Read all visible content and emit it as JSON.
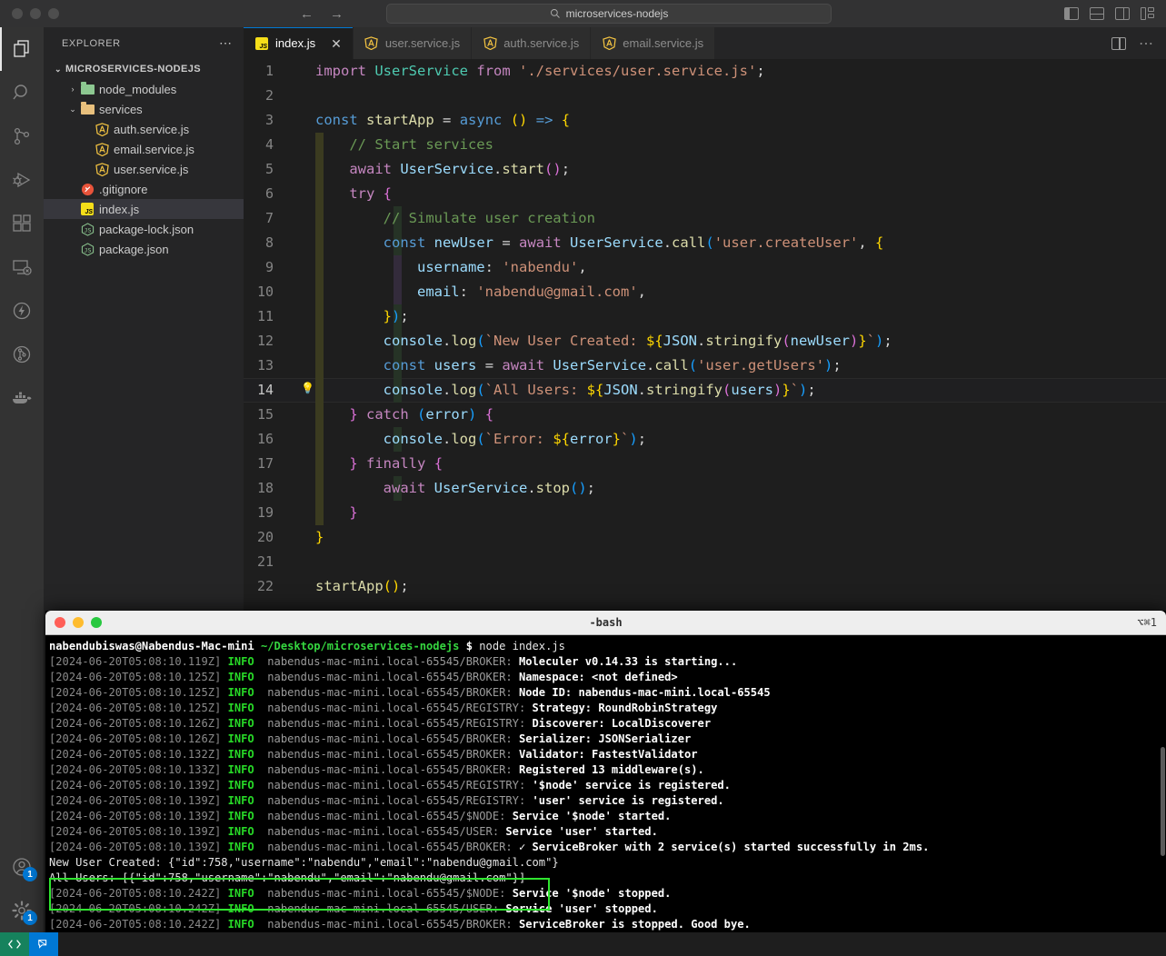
{
  "titlebar": {
    "search_value": "microservices-nodejs",
    "search_icon": "search-icon",
    "back_glyph": "←",
    "forward_glyph": "→"
  },
  "activitybar": {
    "items": [
      {
        "name": "explorer",
        "icon": "files-icon"
      },
      {
        "name": "search",
        "icon": "search-icon"
      },
      {
        "name": "source-control",
        "icon": "source-control-icon"
      },
      {
        "name": "run-and-debug",
        "icon": "run-debug-icon"
      },
      {
        "name": "extensions",
        "icon": "extensions-icon"
      },
      {
        "name": "remote-explorer",
        "icon": "remote-explorer-icon"
      },
      {
        "name": "thunder-client",
        "icon": "thunder-icon"
      },
      {
        "name": "git-graph",
        "icon": "git-graph-icon"
      },
      {
        "name": "docker",
        "icon": "docker-icon"
      }
    ],
    "accounts_badge": "1",
    "settings_badge": "1"
  },
  "sidebar": {
    "title": "EXPLORER",
    "more_actions": "⋯",
    "root": "MICROSERVICES-NODEJS",
    "tree": [
      {
        "label": "node_modules",
        "depth": 1,
        "kind": "folder",
        "color": "#8dc891",
        "expanded": false,
        "chevron": "›"
      },
      {
        "label": "services",
        "depth": 1,
        "kind": "folder",
        "color": "#e8c07d",
        "expanded": true,
        "chevron": "⌄"
      },
      {
        "label": "auth.service.js",
        "depth": 2,
        "kind": "angular",
        "color": "#f5c542"
      },
      {
        "label": "email.service.js",
        "depth": 2,
        "kind": "angular",
        "color": "#f5c542"
      },
      {
        "label": "user.service.js",
        "depth": 2,
        "kind": "angular",
        "color": "#f5c542"
      },
      {
        "label": ".gitignore",
        "depth": 1,
        "kind": "git",
        "color": "#e8533a"
      },
      {
        "label": "index.js",
        "depth": 1,
        "kind": "js",
        "color": "#f5de19",
        "selected": true
      },
      {
        "label": "package-lock.json",
        "depth": 1,
        "kind": "npm",
        "color": "#8dc891"
      },
      {
        "label": "package.json",
        "depth": 1,
        "kind": "npm",
        "color": "#8dc891"
      }
    ]
  },
  "editor": {
    "tabs": [
      {
        "label": "index.js",
        "icon": "js-file-icon",
        "active": true,
        "close": "✕"
      },
      {
        "label": "user.service.js",
        "icon": "angular-file-icon",
        "active": false
      },
      {
        "label": "auth.service.js",
        "icon": "angular-file-icon",
        "active": false
      },
      {
        "label": "email.service.js",
        "icon": "angular-file-icon",
        "active": false
      }
    ],
    "actions": {
      "split_editor": "split-editor-icon",
      "more": "⋯"
    },
    "lightbulb_line": 14,
    "lightbulb_glyph": "💡",
    "lines": [
      {
        "n": 1,
        "html": "<span class='tkey'>import</span> <span class='tcls'>UserService</span> <span class='tkey'>from</span> <span class='tstr'>'./services/user.service.js'</span><span class='tpun'>;</span>"
      },
      {
        "n": 2,
        "html": ""
      },
      {
        "n": 3,
        "html": "<span class='tdecl'>const</span> <span class='tfn'>startApp</span> <span class='tpun'>=</span> <span class='tdecl'>async</span> <span class='py1'>()</span> <span class='tdecl'>=&gt;</span> <span class='py1'>{</span>"
      },
      {
        "n": 4,
        "guide": 1,
        "html": "    <span class='tcom'>// Start services</span>"
      },
      {
        "n": 5,
        "guide": 1,
        "html": "    <span class='tkey'>await</span> <span class='tvar'>UserService</span><span class='tpun'>.</span><span class='tfn'>start</span><span class='py2'>()</span><span class='tpun'>;</span>"
      },
      {
        "n": 6,
        "guide": 1,
        "html": "    <span class='tkey'>try</span> <span class='py2'>{</span>"
      },
      {
        "n": 7,
        "guide": 2,
        "html": "        <span class='tcom'>// Simulate user creation</span>"
      },
      {
        "n": 8,
        "guide": 2,
        "html": "        <span class='tdecl'>const</span> <span class='tvar'>newUser</span> <span class='tpun'>=</span> <span class='tkey'>await</span> <span class='tvar'>UserService</span><span class='tpun'>.</span><span class='tfn'>call</span><span class='py3'>(</span><span class='tstr'>'user.createUser'</span><span class='tpun'>,</span> <span class='py1'>{</span>"
      },
      {
        "n": 9,
        "guide": 3,
        "html": "            <span class='tvar'>username</span><span class='tpun'>:</span> <span class='tstr'>'nabendu'</span><span class='tpun'>,</span>"
      },
      {
        "n": 10,
        "guide": 3,
        "html": "            <span class='tvar'>email</span><span class='tpun'>:</span> <span class='tstr'>'nabendu@gmail.com'</span><span class='tpun'>,</span>"
      },
      {
        "n": 11,
        "guide": 2,
        "html": "        <span class='py1'>}</span><span class='py3'>)</span><span class='tpun'>;</span>"
      },
      {
        "n": 12,
        "guide": 2,
        "html": "        <span class='tvar'>console</span><span class='tpun'>.</span><span class='tfn'>log</span><span class='py3'>(</span><span class='tplt'>`New User Created: </span><span class='py1'>${</span><span class='tvar'>JSON</span><span class='tpun'>.</span><span class='tfn'>stringify</span><span class='py2'>(</span><span class='tvar'>newUser</span><span class='py2'>)</span><span class='py1'>}</span><span class='tplt'>`</span><span class='py3'>)</span><span class='tpun'>;</span>"
      },
      {
        "n": 13,
        "guide": 2,
        "html": "        <span class='tdecl'>const</span> <span class='tvar'>users</span> <span class='tpun'>=</span> <span class='tkey'>await</span> <span class='tvar'>UserService</span><span class='tpun'>.</span><span class='tfn'>call</span><span class='py3'>(</span><span class='tstr'>'user.getUsers'</span><span class='py3'>)</span><span class='tpun'>;</span>"
      },
      {
        "n": 14,
        "guide": 2,
        "current": true,
        "html": "        <span class='tvar'>console</span><span class='tpun'>.</span><span class='tfn'>log</span><span class='py3'>(</span><span class='tplt'>`All Users: </span><span class='py1'>${</span><span class='tvar'>JSON</span><span class='tpun'>.</span><span class='tfn'>stringify</span><span class='py2'>(</span><span class='tvar'>users</span><span class='py2'>)</span><span class='py1'>}</span><span class='tplt'>`</span><span class='py3'>)</span><span class='tpun'>;</span>"
      },
      {
        "n": 15,
        "guide": 1,
        "html": "    <span class='py2'>}</span> <span class='tkey'>catch</span> <span class='py3'>(</span><span class='tvar'>error</span><span class='py3'>)</span> <span class='py2'>{</span>"
      },
      {
        "n": 16,
        "guide": 2,
        "html": "        <span class='tvar'>console</span><span class='tpun'>.</span><span class='tfn'>log</span><span class='py3'>(</span><span class='tplt'>`Error: </span><span class='py1'>${</span><span class='tvar'>error</span><span class='py1'>}</span><span class='tplt'>`</span><span class='py3'>)</span><span class='tpun'>;</span>"
      },
      {
        "n": 17,
        "guide": 1,
        "html": "    <span class='py2'>}</span> <span class='tkey'>finally</span> <span class='py2'>{</span>"
      },
      {
        "n": 18,
        "guide": 2,
        "html": "        <span class='tkey'>await</span> <span class='tvar'>UserService</span><span class='tpun'>.</span><span class='tfn'>stop</span><span class='py3'>()</span><span class='tpun'>;</span>"
      },
      {
        "n": 19,
        "guide": 1,
        "html": "    <span class='py2'>}</span>"
      },
      {
        "n": 20,
        "html": "<span class='py1'>}</span>"
      },
      {
        "n": 21,
        "html": ""
      },
      {
        "n": 22,
        "html": "<span class='tfn'>startApp</span><span class='py1'>()</span><span class='tpun'>;</span>"
      }
    ]
  },
  "terminal": {
    "title": "-bash",
    "shortcut": "⌥⌘1",
    "prompt_user": "nabendubiswas@Nabendus-Mac-mini",
    "prompt_path": "~/Desktop/microservices-nodejs",
    "prompt_sign": "$",
    "command": "node index.js",
    "lines": [
      {
        "ts": "[2024-06-20T05:08:10.119Z]",
        "lvl": "INFO",
        "node": "nabendus-mac-mini.local-65545/BROKER:",
        "msg": "Moleculer v0.14.33 is starting..."
      },
      {
        "ts": "[2024-06-20T05:08:10.125Z]",
        "lvl": "INFO",
        "node": "nabendus-mac-mini.local-65545/BROKER:",
        "msg": "Namespace: <not defined>"
      },
      {
        "ts": "[2024-06-20T05:08:10.125Z]",
        "lvl": "INFO",
        "node": "nabendus-mac-mini.local-65545/BROKER:",
        "msg": "Node ID: nabendus-mac-mini.local-65545"
      },
      {
        "ts": "[2024-06-20T05:08:10.125Z]",
        "lvl": "INFO",
        "node": "nabendus-mac-mini.local-65545/REGISTRY:",
        "msg": "Strategy: RoundRobinStrategy"
      },
      {
        "ts": "[2024-06-20T05:08:10.126Z]",
        "lvl": "INFO",
        "node": "nabendus-mac-mini.local-65545/REGISTRY:",
        "msg": "Discoverer: LocalDiscoverer"
      },
      {
        "ts": "[2024-06-20T05:08:10.126Z]",
        "lvl": "INFO",
        "node": "nabendus-mac-mini.local-65545/BROKER:",
        "msg": "Serializer: JSONSerializer"
      },
      {
        "ts": "[2024-06-20T05:08:10.132Z]",
        "lvl": "INFO",
        "node": "nabendus-mac-mini.local-65545/BROKER:",
        "msg": "Validator: FastestValidator"
      },
      {
        "ts": "[2024-06-20T05:08:10.133Z]",
        "lvl": "INFO",
        "node": "nabendus-mac-mini.local-65545/BROKER:",
        "msg": "Registered 13 middleware(s)."
      },
      {
        "ts": "[2024-06-20T05:08:10.139Z]",
        "lvl": "INFO",
        "node": "nabendus-mac-mini.local-65545/REGISTRY:",
        "msg": "'$node' service is registered."
      },
      {
        "ts": "[2024-06-20T05:08:10.139Z]",
        "lvl": "INFO",
        "node": "nabendus-mac-mini.local-65545/REGISTRY:",
        "msg": "'user' service is registered."
      },
      {
        "ts": "[2024-06-20T05:08:10.139Z]",
        "lvl": "INFO",
        "node": "nabendus-mac-mini.local-65545/$NODE:",
        "msg": "Service '$node' started."
      },
      {
        "ts": "[2024-06-20T05:08:10.139Z]",
        "lvl": "INFO",
        "node": "nabendus-mac-mini.local-65545/USER:",
        "msg": "Service 'user' started."
      },
      {
        "ts": "[2024-06-20T05:08:10.139Z]",
        "lvl": "INFO",
        "node": "nabendus-mac-mini.local-65545/BROKER:",
        "msg": "✓ ServiceBroker with 2 service(s) started successfully in 2ms."
      }
    ],
    "highlighted": [
      "New User Created: {\"id\":758,\"username\":\"nabendu\",\"email\":\"nabendu@gmail.com\"}",
      "All Users: [{\"id\":758,\"username\":\"nabendu\",\"email\":\"nabendu@gmail.com\"}]"
    ],
    "highlight_color": "#2fe52f",
    "lines_after": [
      {
        "ts": "[2024-06-20T05:08:10.242Z]",
        "lvl": "INFO",
        "node": "nabendus-mac-mini.local-65545/$NODE:",
        "msg": "Service '$node' stopped."
      },
      {
        "ts": "[2024-06-20T05:08:10.242Z]",
        "lvl": "INFO",
        "node": "nabendus-mac-mini.local-65545/USER:",
        "msg": "Service 'user' stopped."
      },
      {
        "ts": "[2024-06-20T05:08:10.242Z]",
        "lvl": "INFO",
        "node": "nabendus-mac-mini.local-65545/BROKER:",
        "msg": "ServiceBroker is stopped. Good bye."
      }
    ]
  },
  "statusbar": {
    "remote_icon": "remote-window-icon",
    "sync_icon": "live-share-icon"
  },
  "colors": {
    "accent": "#0078d4",
    "remote_green": "#16825d",
    "terminal_green": "#27d827",
    "editor_bg": "#1e1e1e"
  }
}
